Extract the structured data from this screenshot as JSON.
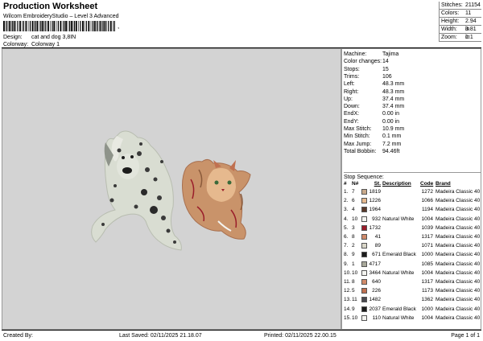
{
  "header": {
    "title": "Production Worksheet",
    "product": "Wilcom EmbroideryStudio – Level 3 Advanced",
    "barcode_text": ",",
    "design_label": "Design:",
    "design_value": "cat and dog 3,8IN",
    "colorway_label": "Colorway:",
    "colorway_value": "Colorway 1"
  },
  "summary": [
    {
      "label": "Stitches:",
      "value": "21154"
    },
    {
      "label": "Colors:",
      "value": "11"
    },
    {
      "label": "Height:",
      "value": "2.94 in"
    },
    {
      "label": "Width:",
      "value": "3.81 in"
    },
    {
      "label": "Zoom:",
      "value": "1:1"
    }
  ],
  "machine_info": [
    {
      "label": "Machine:",
      "value": "Tajima"
    },
    {
      "label": "Color changes:",
      "value": "14"
    },
    {
      "label": "Stops:",
      "value": "15"
    },
    {
      "label": "Trims:",
      "value": "106"
    },
    {
      "label": "Left:",
      "value": "48.3 mm"
    },
    {
      "label": "Right:",
      "value": "48.3 mm"
    },
    {
      "label": "Up:",
      "value": "37.4 mm"
    },
    {
      "label": "Down:",
      "value": "37.4 mm"
    },
    {
      "label": "EndX:",
      "value": "0.00 in"
    },
    {
      "label": "EndY:",
      "value": "0.00 in"
    },
    {
      "label": "Max Stitch:",
      "value": "10.9 mm"
    },
    {
      "label": "Min Stitch:",
      "value": "0.1 mm"
    },
    {
      "label": "Max Jump:",
      "value": "7.2 mm"
    },
    {
      "label": "Total Bobbin:",
      "value": "94.46ft"
    }
  ],
  "stop_sequence": {
    "title": "Stop Sequence:",
    "headers": {
      "hash": "#",
      "n": "N#",
      "st": "St.",
      "desc": "Description",
      "code": "Code",
      "brand": "Brand"
    },
    "rows": [
      {
        "hash": "1.",
        "n": "7",
        "color": "#c8a98a",
        "st": "1819",
        "desc": "",
        "code": "1272",
        "brand": "Madeira Classic 40"
      },
      {
        "hash": "2.",
        "n": "6",
        "color": "#e6b98e",
        "st": "1226",
        "desc": "",
        "code": "1066",
        "brand": "Madeira Classic 40"
      },
      {
        "hash": "3.",
        "n": "4",
        "color": "#5a3a2a",
        "st": "1964",
        "desc": "",
        "code": "1194",
        "brand": "Madeira Classic 40"
      },
      {
        "hash": "4.",
        "n": "10",
        "color": "#f4f4f0",
        "st": "932",
        "desc": "Natural White",
        "code": "1004",
        "brand": "Madeira Classic 40"
      },
      {
        "hash": "5.",
        "n": "3",
        "color": "#9a1d2a",
        "st": "1732",
        "desc": "",
        "code": "1039",
        "brand": "Madeira Classic 40"
      },
      {
        "hash": "6.",
        "n": "8",
        "color": "#d08a6a",
        "st": "41",
        "desc": "",
        "code": "1317",
        "brand": "Madeira Classic 40"
      },
      {
        "hash": "7.",
        "n": "2",
        "color": "#d9d6c8",
        "st": "89",
        "desc": "",
        "code": "1071",
        "brand": "Madeira Classic 40"
      },
      {
        "hash": "8.",
        "n": "9",
        "color": "#1c1c1c",
        "st": "671",
        "desc": "Emerald Black",
        "code": "1000",
        "brand": "Madeira Classic 40"
      },
      {
        "hash": "9.",
        "n": "1",
        "color": "#a8a89a",
        "st": "4717",
        "desc": "",
        "code": "1085",
        "brand": "Madeira Classic 40"
      },
      {
        "hash": "10.",
        "n": "10",
        "color": "#f4f4f0",
        "st": "3464",
        "desc": "Natural White",
        "code": "1004",
        "brand": "Madeira Classic 40"
      },
      {
        "hash": "11.",
        "n": "8",
        "color": "#d08a6a",
        "st": "640",
        "desc": "",
        "code": "1317",
        "brand": "Madeira Classic 40"
      },
      {
        "hash": "12.",
        "n": "5",
        "color": "#c07050",
        "st": "226",
        "desc": "",
        "code": "1173",
        "brand": "Madeira Classic 40"
      },
      {
        "hash": "13.",
        "n": "11",
        "color": "#4a4a50",
        "st": "1482",
        "desc": "",
        "code": "1362",
        "brand": "Madeira Classic 40"
      },
      {
        "hash": "14.",
        "n": "9",
        "color": "#1c1c1c",
        "st": "2037",
        "desc": "Emerald Black",
        "code": "1000",
        "brand": "Madeira Classic 40"
      },
      {
        "hash": "15.",
        "n": "10",
        "color": "#f4f4f0",
        "st": "110",
        "desc": "Natural White",
        "code": "1004",
        "brand": "Madeira Classic 40"
      }
    ]
  },
  "footer": {
    "created_by": "Created By:",
    "last_saved": "Last Saved: 02/11/2025 21.18.07",
    "printed": "Printed: 02/11/2025 22.00.15",
    "page": "Page 1 of 1"
  }
}
